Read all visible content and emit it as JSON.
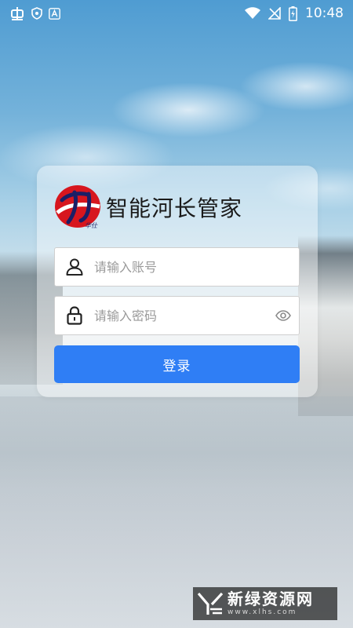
{
  "status_bar": {
    "time": "10:48",
    "left_icons": [
      "carrier-bug-icon",
      "shield-icon",
      "app-a-icon"
    ],
    "right_icons": [
      "wifi-icon",
      "signal-off-icon",
      "battery-charging-icon"
    ]
  },
  "login": {
    "app_title": "智能河长管家",
    "logo_caption": "华仕",
    "account_placeholder": "请输入账号",
    "password_placeholder": "请输入密码",
    "login_label": "登录"
  },
  "watermark": {
    "title": "新绿资源网",
    "subtitle": "www.xlhs.com"
  },
  "colors": {
    "primary": "#2f7ef5",
    "logo_red": "#d7161e",
    "logo_navy": "#1b1f66"
  }
}
